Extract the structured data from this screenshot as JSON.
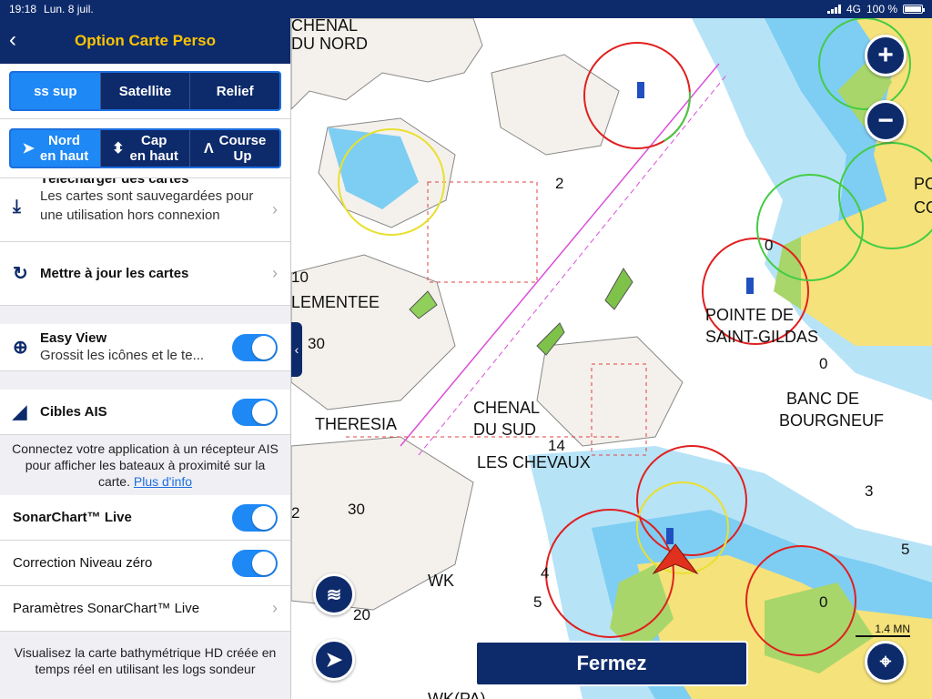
{
  "status": {
    "time": "19:18",
    "date": "Lun. 8 juil.",
    "network": "4G",
    "battery": "100 %"
  },
  "nav": {
    "title": "Option Carte Perso",
    "back_icon": "chevron-left-icon"
  },
  "map_type": {
    "options": [
      "ss sup",
      "Satellite",
      "Relief"
    ],
    "selected": "ss sup"
  },
  "orientation": {
    "options": [
      {
        "line1": "Nord",
        "line2": "en haut",
        "icon": "arrow-north-icon"
      },
      {
        "line1": "Cap",
        "line2": "en haut",
        "icon": "heading-icon"
      },
      {
        "line1": "Course",
        "line2": "Up",
        "icon": "course-icon"
      }
    ],
    "selected": "Nord en haut"
  },
  "download": {
    "title": "Télécharger des cartes",
    "desc": "Les cartes sont sauvegardées pour une utilisation hors connexion"
  },
  "update": {
    "title": "Mettre à jour les cartes"
  },
  "easy_view": {
    "title": "Easy View",
    "desc": "Grossit les icônes et le te...",
    "on": true
  },
  "ais": {
    "title": "Cibles AIS",
    "on": true,
    "info": "Connectez votre application à un récepteur AIS pour afficher les bateaux à proximité sur la carte.",
    "link": "Plus d'info"
  },
  "sonar": {
    "title": "SonarChart™ Live",
    "on": true
  },
  "correction": {
    "title": "Correction Niveau zéro",
    "on": true
  },
  "sonar_params": {
    "title": "Paramètres SonarChart™ Live"
  },
  "bottom_info": "Visualisez la carte bathymétrique HD créée en temps réel en utilisant les logs sondeur",
  "map": {
    "labels": {
      "chenal_nord_1": "CHENAL",
      "chenal_nord_2": "DU NORD",
      "clementee": "LEMENTEE",
      "pointe1": "POINTE DE",
      "pointe2": "SAINT-GILDAS",
      "theresia": "THERESIA",
      "chenal_sud1": "CHENAL",
      "chenal_sud2": "DU SUD",
      "chevaux": "LES CHEVAUX",
      "banc1": "BANC DE",
      "banc2": "BOURGNEUF",
      "wk": "WK",
      "wkpa": "WK(PA)",
      "po": "PO",
      "co": "CO"
    },
    "depths": [
      "10",
      "30",
      "14",
      "2",
      "30",
      "2",
      "0",
      "0",
      "3",
      "5",
      "0",
      "20",
      "4",
      "5"
    ],
    "scale": "1.4 MN",
    "close_label": "Fermez",
    "colors": {
      "land": "#f5e27a",
      "shallow": "#7ecdf3",
      "deep": "#b7e3f7",
      "water": "#ffffff",
      "nav_blue": "#0d2a6b",
      "toggle_blue": "#1e88f5",
      "title_yellow": "#ffc400"
    }
  }
}
